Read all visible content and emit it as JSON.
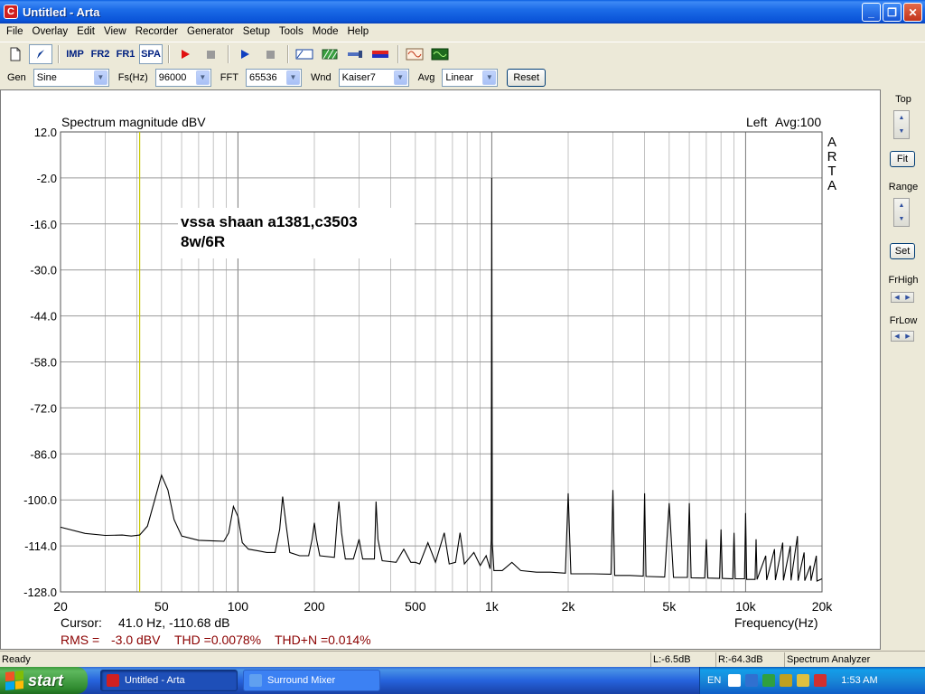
{
  "window": {
    "title": "Untitled - Arta"
  },
  "menu": [
    "File",
    "Overlay",
    "Edit",
    "View",
    "Recorder",
    "Generator",
    "Setup",
    "Tools",
    "Mode",
    "Help"
  ],
  "toolbar": {
    "imp_label": "IMP",
    "fr2_label": "FR2",
    "fr1_label": "FR1",
    "spa_label": "SPA"
  },
  "params": {
    "gen_label": "Gen",
    "gen_value": "Sine",
    "fs_label": "Fs(Hz)",
    "fs_value": "96000",
    "fft_label": "FFT",
    "fft_value": "65536",
    "wnd_label": "Wnd",
    "wnd_value": "Kaiser7",
    "avg_label": "Avg",
    "avg_value": "Linear",
    "reset_label": "Reset"
  },
  "side": {
    "top_label": "Top",
    "fit_label": "Fit",
    "range_label": "Range",
    "set_label": "Set",
    "frhigh_label": "FrHigh",
    "frlow_label": "FrLow"
  },
  "plot": {
    "title": "Spectrum magnitude dBV",
    "channel": "Left",
    "avg": "Avg:100",
    "watermark": "ARTA",
    "annotation_line1": "vssa shaan a1381,c3503",
    "annotation_line2": "8w/6R",
    "cursor_label": "Cursor:",
    "cursor_value": "41.0 Hz, -110.68 dB",
    "rms_label": "RMS =",
    "rms_value": "-3.0 dBV",
    "thd_text": "THD =0.0078%",
    "thdn_text": "THD+N =0.014%",
    "xlabel": "Frequency(Hz)"
  },
  "colors": {
    "trace": "#000000",
    "grid": "#9a9a9a",
    "cursor": "#c8c800",
    "rms_text": "#8b0000"
  },
  "chart_data": {
    "type": "line",
    "title": "Spectrum magnitude dBV",
    "xlabel": "Frequency(Hz)",
    "ylabel": "",
    "xscale": "log",
    "xlim": [
      20,
      20000
    ],
    "ylim": [
      -128.0,
      12.0
    ],
    "yticks": [
      "12.0",
      "-2.0",
      "-16.0",
      "-30.0",
      "-44.0",
      "-58.0",
      "-72.0",
      "-86.0",
      "-100.0",
      "-114.0",
      "-128.0"
    ],
    "xticks": [
      {
        "value": 20,
        "label": "20"
      },
      {
        "value": 50,
        "label": "50"
      },
      {
        "value": 100,
        "label": "100"
      },
      {
        "value": 200,
        "label": "200"
      },
      {
        "value": 500,
        "label": "500"
      },
      {
        "value": 1000,
        "label": "1k"
      },
      {
        "value": 2000,
        "label": "2k"
      },
      {
        "value": 5000,
        "label": "5k"
      },
      {
        "value": 10000,
        "label": "10k"
      },
      {
        "value": 20000,
        "label": "20k"
      }
    ],
    "cursor_hz": 41.0,
    "series": [
      {
        "points": [
          [
            20,
            -108.3
          ],
          [
            25,
            -110.2
          ],
          [
            30,
            -110.8
          ],
          [
            35,
            -110.7
          ],
          [
            38,
            -111.0
          ],
          [
            41,
            -110.7
          ],
          [
            44,
            -108.0
          ],
          [
            47,
            -100.0
          ],
          [
            50,
            -92.5
          ],
          [
            53,
            -97.0
          ],
          [
            56,
            -106.0
          ],
          [
            60,
            -111.0
          ],
          [
            70,
            -112.3
          ],
          [
            80,
            -112.5
          ],
          [
            88,
            -112.6
          ],
          [
            92,
            -110.0
          ],
          [
            96,
            -102.0
          ],
          [
            100,
            -105.0
          ],
          [
            104,
            -113.0
          ],
          [
            110,
            -115.0
          ],
          [
            120,
            -115.5
          ],
          [
            130,
            -116.0
          ],
          [
            140,
            -116.0
          ],
          [
            146,
            -109.0
          ],
          [
            150,
            -99.0
          ],
          [
            155,
            -108.0
          ],
          [
            160,
            -116.0
          ],
          [
            175,
            -117.0
          ],
          [
            190,
            -117.0
          ],
          [
            196,
            -112.0
          ],
          [
            200,
            -107.0
          ],
          [
            204,
            -112.0
          ],
          [
            210,
            -117.0
          ],
          [
            240,
            -117.5
          ],
          [
            246,
            -106.0
          ],
          [
            250,
            -100.5
          ],
          [
            256,
            -110.0
          ],
          [
            265,
            -118.0
          ],
          [
            285,
            -118.0
          ],
          [
            300,
            -112.0
          ],
          [
            310,
            -118.0
          ],
          [
            345,
            -118.0
          ],
          [
            350,
            -100.5
          ],
          [
            356,
            -112.0
          ],
          [
            370,
            -118.5
          ],
          [
            420,
            -119.0
          ],
          [
            450,
            -115.0
          ],
          [
            480,
            -119.0
          ],
          [
            500,
            -119.0
          ],
          [
            520,
            -119.5
          ],
          [
            560,
            -113.0
          ],
          [
            600,
            -119.0
          ],
          [
            650,
            -110.0
          ],
          [
            680,
            -119.5
          ],
          [
            720,
            -119.0
          ],
          [
            750,
            -110.0
          ],
          [
            780,
            -119.5
          ],
          [
            850,
            -116.0
          ],
          [
            900,
            -120.0
          ],
          [
            950,
            -117.0
          ],
          [
            985,
            -121.0
          ],
          [
            995,
            -112.0
          ],
          [
            1000,
            -2.0
          ],
          [
            1005,
            -113.0
          ],
          [
            1020,
            -121.5
          ],
          [
            1100,
            -121.5
          ],
          [
            1200,
            -119.0
          ],
          [
            1300,
            -121.5
          ],
          [
            1500,
            -122.0
          ],
          [
            1700,
            -122.0
          ],
          [
            1950,
            -122.3
          ],
          [
            2000,
            -98.0
          ],
          [
            2050,
            -122.5
          ],
          [
            2500,
            -122.5
          ],
          [
            2950,
            -122.6
          ],
          [
            3000,
            -97.0
          ],
          [
            3050,
            -123.0
          ],
          [
            3500,
            -123.0
          ],
          [
            3950,
            -123.2
          ],
          [
            4000,
            -98.0
          ],
          [
            4050,
            -123.3
          ],
          [
            4800,
            -123.5
          ],
          [
            5000,
            -101.0
          ],
          [
            5200,
            -123.6
          ],
          [
            5900,
            -123.6
          ],
          [
            6000,
            -101.0
          ],
          [
            6100,
            -123.7
          ],
          [
            6900,
            -123.8
          ],
          [
            7000,
            -112.0
          ],
          [
            7100,
            -123.8
          ],
          [
            7900,
            -123.9
          ],
          [
            8000,
            -109.0
          ],
          [
            8100,
            -123.9
          ],
          [
            8900,
            -124.0
          ],
          [
            9000,
            -110.0
          ],
          [
            9100,
            -124.0
          ],
          [
            9900,
            -124.0
          ],
          [
            10000,
            -104.0
          ],
          [
            10100,
            -124.2
          ],
          [
            10900,
            -124.2
          ],
          [
            11000,
            -112.0
          ],
          [
            11100,
            -124.2
          ],
          [
            12000,
            -117.0
          ],
          [
            12100,
            -124.4
          ],
          [
            13000,
            -115.0
          ],
          [
            13100,
            -124.4
          ],
          [
            14000,
            -113.0
          ],
          [
            14100,
            -124.5
          ],
          [
            15000,
            -114.0
          ],
          [
            15100,
            -124.5
          ],
          [
            16000,
            -111.0
          ],
          [
            16100,
            -124.6
          ],
          [
            17000,
            -116.0
          ],
          [
            17100,
            -124.6
          ],
          [
            18000,
            -120.0
          ],
          [
            18100,
            -124.6
          ],
          [
            19000,
            -117.0
          ],
          [
            19100,
            -124.7
          ],
          [
            20000,
            -124.0
          ]
        ]
      }
    ]
  },
  "statusbar": {
    "ready": "Ready",
    "left_level": "L:-6.5dB",
    "right_level": "R:-64.3dB",
    "mode": "Spectrum Analyzer"
  },
  "taskbar": {
    "start_label": "start",
    "task1": "Untitled - Arta",
    "task2": "Surround Mixer",
    "lang": "EN",
    "clock": "1:53 AM"
  }
}
